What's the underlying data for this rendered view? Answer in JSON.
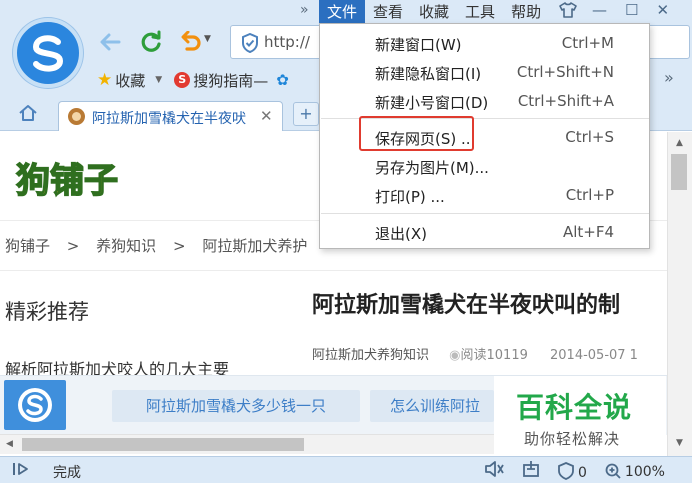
{
  "browser": {
    "address_text": "http://",
    "bookmarks": {
      "favorites_label": "收藏",
      "sogou_guide_label": "搜狗指南—"
    },
    "tab": {
      "title": "阿拉斯加雪橇犬在半夜吠"
    },
    "menubar": [
      "文件",
      "查看",
      "收藏",
      "工具",
      "帮助"
    ],
    "file_menu": {
      "items": [
        {
          "label": "新建窗口(W)",
          "shortcut": "Ctrl+M"
        },
        {
          "label": "新建隐私窗口(I)",
          "shortcut": "Ctrl+Shift+N"
        },
        {
          "label": "新建小号窗口(D)",
          "shortcut": "Ctrl+Shift+A"
        },
        {
          "label": "保存网页(S) ...",
          "shortcut": "Ctrl+S"
        },
        {
          "label": "另存为图片(M)...",
          "shortcut": ""
        },
        {
          "label": "打印(P) ...",
          "shortcut": "Ctrl+P"
        },
        {
          "label": "退出(X)",
          "shortcut": "Alt+F4"
        }
      ],
      "highlight_color": "#e03b2f"
    },
    "status": {
      "text": "完成",
      "adblock_count": "0",
      "zoom": "100%"
    },
    "accent_color": "#2b6fc0"
  },
  "page": {
    "site_logo_text": "狗铺子",
    "breadcrumb": [
      "狗铺子",
      "养狗知识",
      "阿拉斯加犬养护"
    ],
    "featured_title": "精彩推荐",
    "featured_item": "解析阿拉斯加犬咬人的几大主要",
    "article_title": "阿拉斯加雪橇犬在半夜吠叫的制",
    "article_meta": {
      "category": "阿拉斯加犬养狗知识",
      "views": "阅读10119",
      "date": "2014-05-07 1"
    },
    "ad_links": [
      "阿拉斯加雪橇犬多少钱一只",
      "怎么训练阿拉"
    ]
  },
  "watermark": {
    "title": "百科全说",
    "subtitle": "助你轻松解决",
    "color": "#22a84a"
  }
}
